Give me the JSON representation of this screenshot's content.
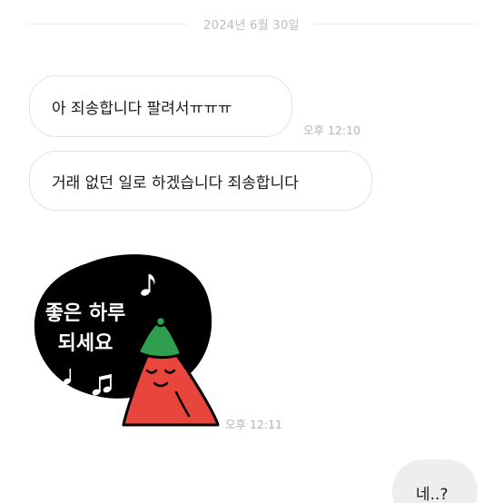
{
  "date_divider": "2024년 6월 30일",
  "messages": [
    {
      "text": "아 죄송합니다 팔려서ㅠㅠㅠ",
      "time": "오후 12:10"
    },
    {
      "text": "거래 없던 일로 하겠습니다 죄송합니다"
    }
  ],
  "sticker": {
    "line1": "좋은 하루",
    "line2": "되세요",
    "time": "오후 12:11"
  },
  "my_message": {
    "text": "네..?"
  },
  "icons": {
    "note_single": "eighth-note-icon",
    "note_double": "beamed-notes-icon"
  },
  "colors": {
    "sticker_blob": "#000000",
    "character_red": "#e8453c",
    "hat_green": "#2f9e4f",
    "my_bubble_bg": "#eeeeee"
  }
}
